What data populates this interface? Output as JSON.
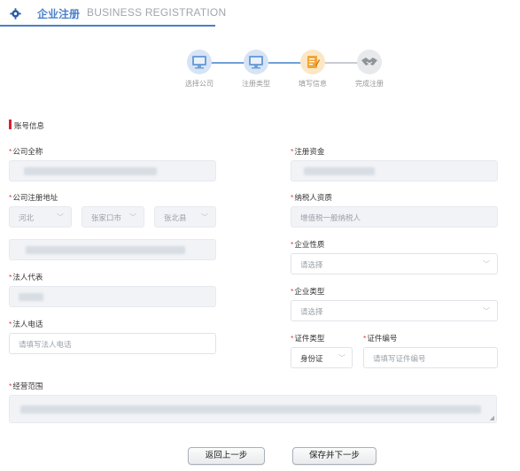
{
  "header": {
    "tab_title": "企业注册",
    "tab_subtitle": "BUSINESS REGISTRATION"
  },
  "steps": [
    {
      "label": "选择公司",
      "icon": "monitor-icon",
      "color": "#6f9fd8"
    },
    {
      "label": "注册类型",
      "icon": "monitor-icon",
      "color": "#6f9fd8"
    },
    {
      "label": "填写信息",
      "icon": "edit-form-icon",
      "color": "#f0a63a"
    },
    {
      "label": "完成注册",
      "icon": "handshake-icon",
      "color": "#a9adb2"
    }
  ],
  "section": {
    "title": "账号信息"
  },
  "form": {
    "company_name": {
      "label": "公司全称"
    },
    "registered_capital": {
      "label": "注册资金"
    },
    "address": {
      "label": "公司注册地址",
      "province": "河北",
      "city": "张家口市",
      "district": "张北县"
    },
    "taxpayer": {
      "label": "纳税人资质",
      "value": "增值税一般纳税人"
    },
    "enterprise_nature": {
      "label": "企业性质",
      "placeholder": "请选择"
    },
    "legal_rep": {
      "label": "法人代表"
    },
    "enterprise_type": {
      "label": "企业类型",
      "placeholder": "请选择"
    },
    "legal_phone": {
      "label": "法人电话",
      "placeholder": "请填写法人电话"
    },
    "cert_type": {
      "label": "证件类型",
      "value": "身份证"
    },
    "cert_no": {
      "label": "证件编号",
      "placeholder": "请填写证件编号"
    },
    "business_scope": {
      "label": "经营范围"
    }
  },
  "buttons": {
    "back": "返回上一步",
    "next": "保存并下一步"
  },
  "colors": {
    "accent": "#4a7fc8",
    "required": "#e04040",
    "section_bar": "#d9232d"
  }
}
